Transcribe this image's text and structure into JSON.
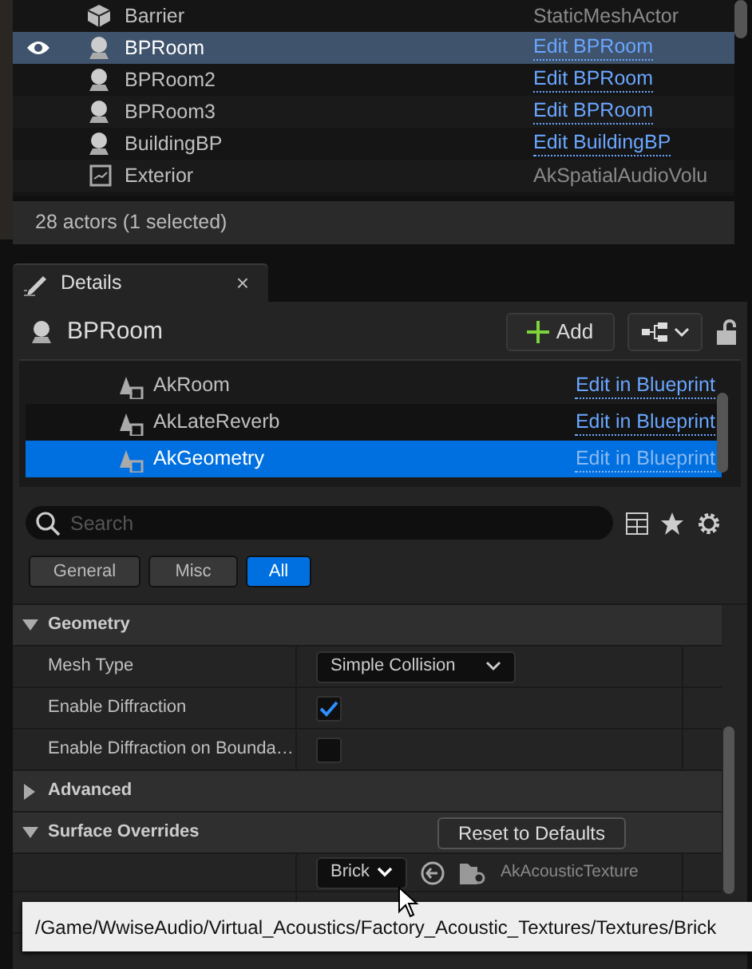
{
  "outliner": {
    "rows": [
      {
        "label": "Barrier",
        "kind": "mesh",
        "type": "StaticMeshActor",
        "selected": false,
        "eye": false
      },
      {
        "label": "BPRoom",
        "kind": "blueprint",
        "link": "Edit BPRoom",
        "selected": true,
        "eye": true
      },
      {
        "label": "BPRoom2",
        "kind": "blueprint",
        "link": "Edit BPRoom",
        "selected": false,
        "eye": false
      },
      {
        "label": "BPRoom3",
        "kind": "blueprint",
        "link": "Edit BPRoom",
        "selected": false,
        "eye": false
      },
      {
        "label": "BuildingBP",
        "kind": "blueprint",
        "link": "Edit BuildingBP",
        "selected": false,
        "eye": false
      },
      {
        "label": "Exterior",
        "kind": "volume",
        "type": "AkSpatialAudioVolu",
        "selected": false,
        "eye": false
      }
    ],
    "status": "28 actors (1 selected)"
  },
  "details": {
    "tab": {
      "title": "Details",
      "close": "×"
    },
    "actor": "BPRoom",
    "add_button": "Add",
    "components": [
      {
        "label": "AkRoom",
        "link": "Edit in Blueprint",
        "selected": false
      },
      {
        "label": "AkLateReverb",
        "link": "Edit in Blueprint",
        "selected": false
      },
      {
        "label": "AkGeometry",
        "link": "Edit in Blueprint",
        "selected": true
      }
    ],
    "search": {
      "placeholder": "Search"
    },
    "filters": [
      {
        "label": "General",
        "selected": false
      },
      {
        "label": "Misc",
        "selected": false
      },
      {
        "label": "All",
        "selected": true
      }
    ],
    "properties": [
      {
        "kind": "category",
        "label": "Geometry",
        "expanded": true
      },
      {
        "kind": "dropdown",
        "label": "Mesh Type",
        "value": "Simple Collision"
      },
      {
        "kind": "checkbox",
        "label": "Enable Diffraction",
        "checked": true
      },
      {
        "kind": "checkbox",
        "label": "Enable Diffraction on Bounda…",
        "checked": false
      },
      {
        "kind": "category",
        "label": "Advanced",
        "expanded": false
      },
      {
        "kind": "category",
        "label": "Surface Overrides",
        "expanded": true,
        "button": "Reset to Defaults"
      },
      {
        "kind": "asset",
        "value": "Brick",
        "asset_type": "AkAcousticTexture"
      },
      {
        "kind": "blank"
      }
    ],
    "tooltip": "/Game/WwiseAudio/Virtual_Acoustics/Factory_Acoustic_Textures/Textures/Brick"
  }
}
